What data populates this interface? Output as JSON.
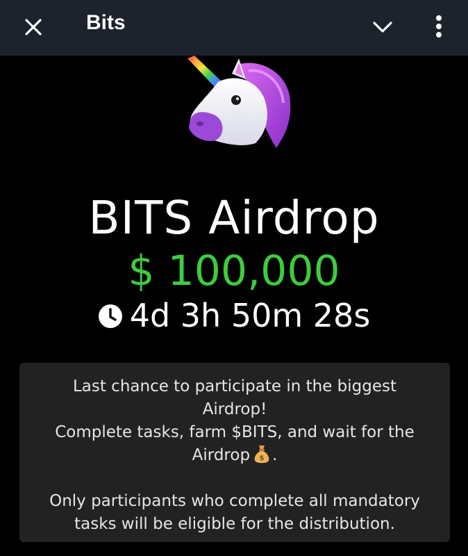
{
  "header": {
    "title": "Bits",
    "close_icon": "close-icon",
    "chevron_icon": "chevron-down-icon",
    "more_icon": "more-vertical-icon",
    "background": "#1c232c"
  },
  "hero": {
    "image_icon": "unicorn-icon",
    "headline": "BITS Airdrop",
    "amount": "$ 100,000",
    "amount_color": "#3ecb3e",
    "timer_icon": "clock-icon",
    "timer": "4d 3h 50m 28s"
  },
  "card": {
    "line1": "Last chance to participate in the biggest",
    "line2": "Airdrop!",
    "line3": "Complete tasks, farm $BITS, and wait for the",
    "line4_text": "Airdrop",
    "line4_icon": "money-bag-icon",
    "line4_end": ".",
    "line5": "Only participants who complete all mandatory",
    "line6": "tasks will be eligible for the distribution."
  }
}
